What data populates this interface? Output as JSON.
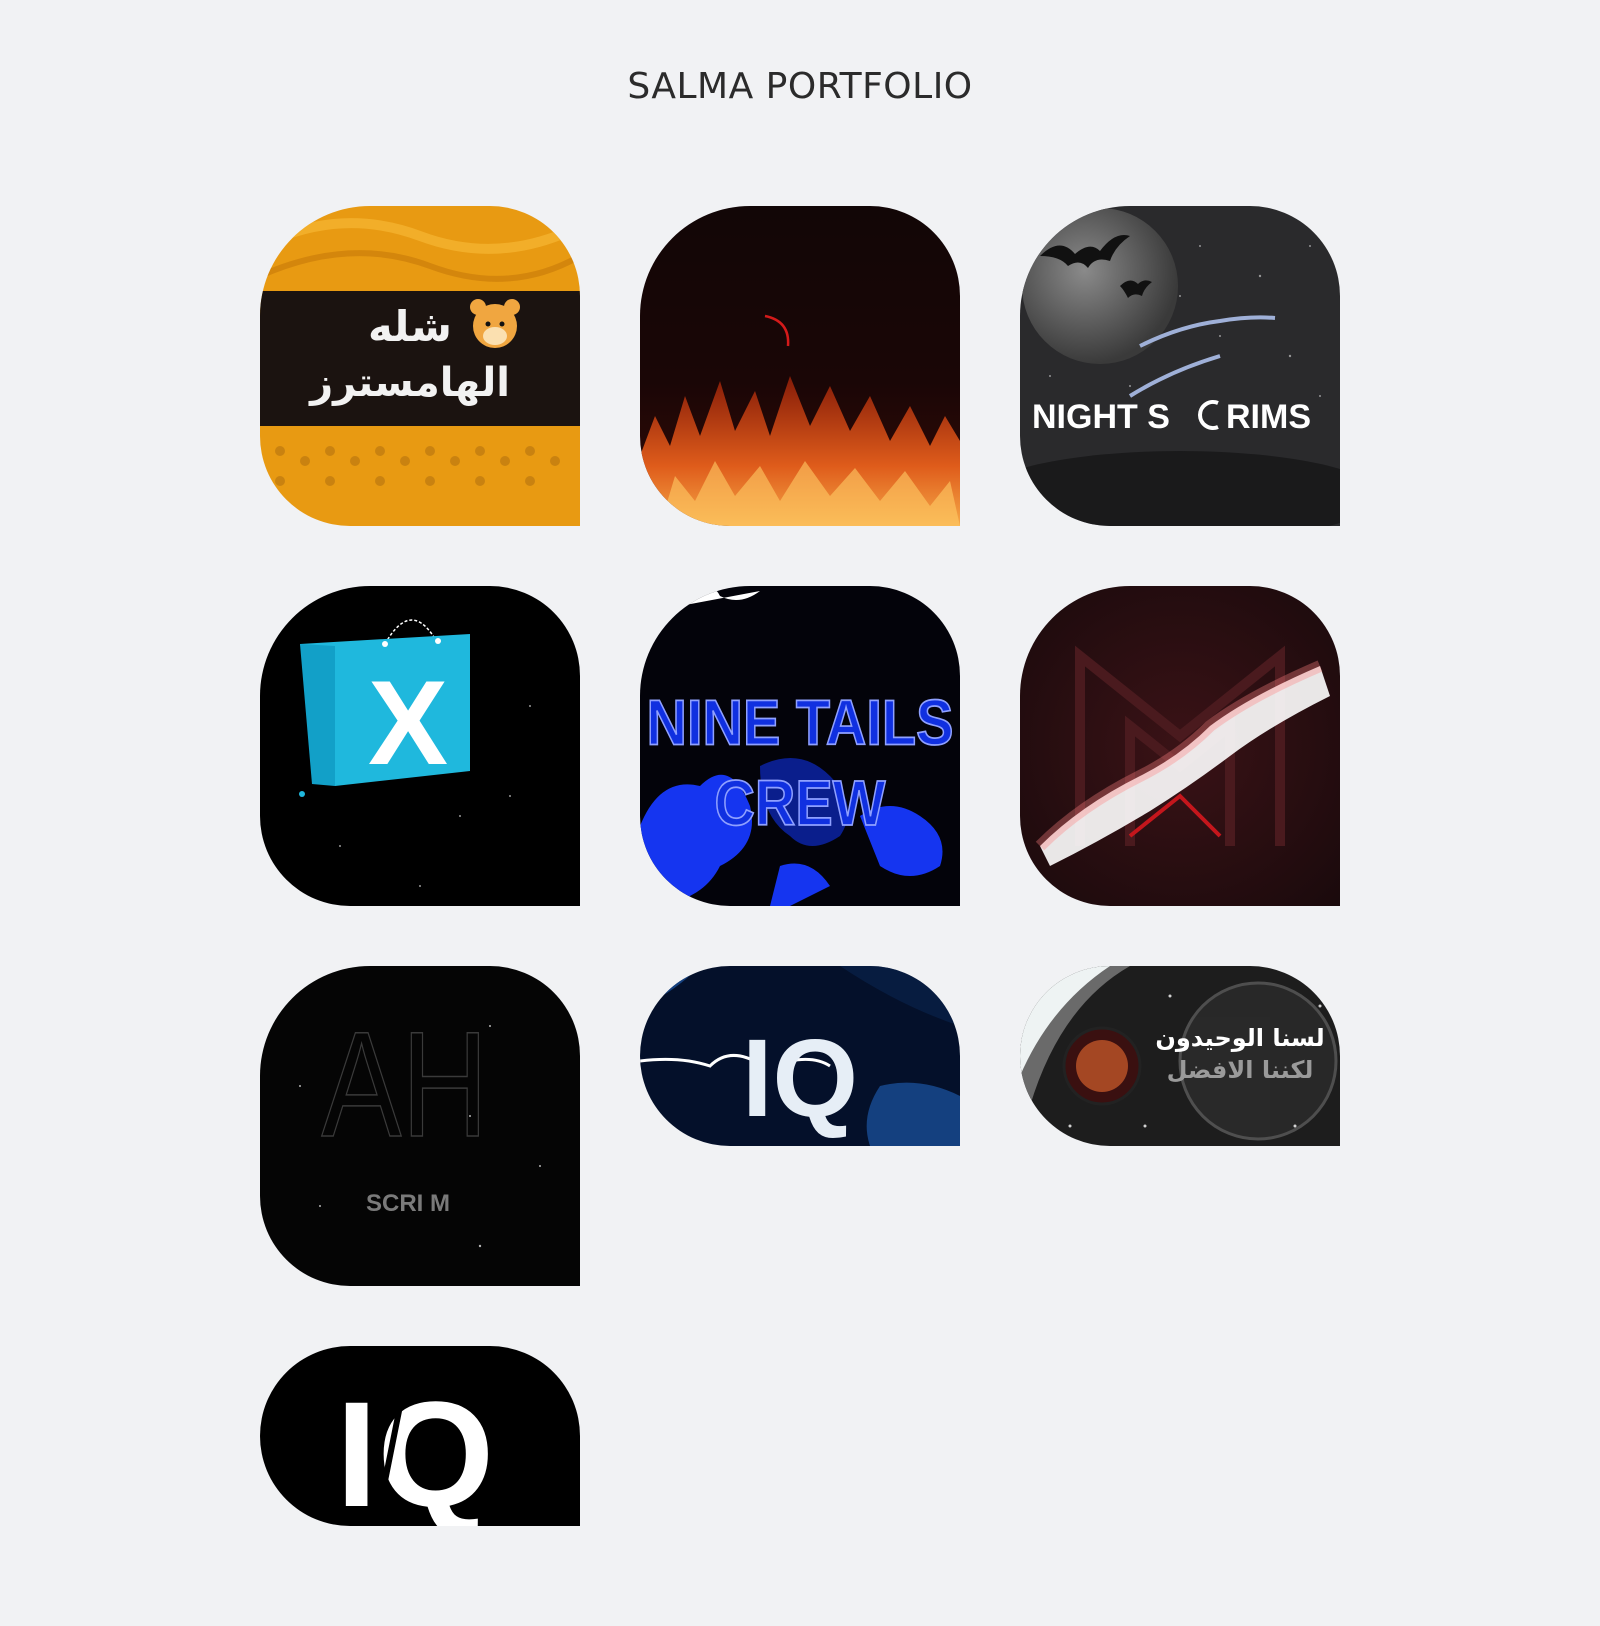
{
  "header": {
    "title": "SALMA PORTFOLIO"
  },
  "portfolio": {
    "items": [
      {
        "name": "hamsters",
        "lines": [
          "شله",
          "الهامسترز"
        ],
        "colors": {
          "bg": "#e89a12",
          "band": "#1b1310",
          "text": "#f2f2f2"
        }
      },
      {
        "name": "fire",
        "colors": {
          "bg": "#120606",
          "flame": "#d9501a"
        }
      },
      {
        "name": "night-scrims",
        "title_part1": "NIGHT S",
        "title_part2": "RIMS",
        "colors": {
          "bg": "#2a2a2c",
          "text": "#ffffff"
        }
      },
      {
        "name": "x-bag",
        "letter": "X",
        "colors": {
          "bg": "#000000",
          "bag": "#1fb8dd"
        }
      },
      {
        "name": "nine-tails-crew",
        "line1": "NINE TAILS",
        "line2": "CREW",
        "colors": {
          "bg": "#03030a",
          "text": "#1030e0",
          "shape": "#1535f0"
        }
      },
      {
        "name": "red-m-logo",
        "colors": {
          "bg": "#230d10",
          "glow": "#ffffff",
          "accent": "#c4161c"
        }
      },
      {
        "name": "ah-scrim",
        "letters": "AH",
        "word": "SCRI M",
        "colors": {
          "bg": "#050505",
          "text": "#7a7a7a"
        }
      },
      {
        "name": "iq-animated",
        "letters": "IQ",
        "colors": {
          "bg": "#04102a",
          "wave": "#14407f",
          "text": "#e6eef6"
        }
      },
      {
        "name": "arabic-banner",
        "line1": "لسنا الوحيدون",
        "line2": "لكننا الافضل",
        "colors": {
          "bg": "#1d1d1d",
          "text": "#ffffff"
        }
      },
      {
        "name": "iq-logo",
        "letters": "IQ",
        "colors": {
          "bg": "#000000",
          "text": "#ffffff"
        }
      }
    ]
  }
}
